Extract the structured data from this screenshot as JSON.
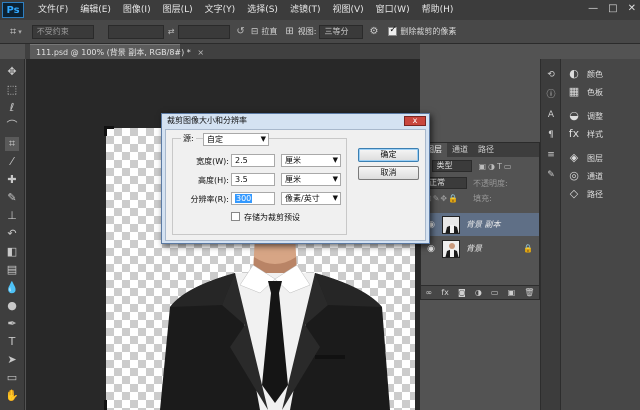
{
  "app": {
    "logo": "Ps",
    "menu": [
      "文件(F)",
      "编辑(E)",
      "图像(I)",
      "图层(L)",
      "文字(Y)",
      "选择(S)",
      "滤镜(T)",
      "视图(V)",
      "窗口(W)",
      "帮助(H)"
    ],
    "window_controls": [
      "—",
      "□",
      "✕"
    ]
  },
  "options_bar": {
    "ratio_select": "不受约束",
    "straighten_label": "拉直",
    "view_label": "视图:",
    "view_value": "三等分",
    "delete_cropped_label": "删除裁剪的像素",
    "delete_cropped_checked": true
  },
  "document": {
    "tab_title": "111.psd @ 100% (背景 副本, RGB/8#) *",
    "tab_close": "×"
  },
  "dock": {
    "items": [
      {
        "icon": "palette-icon",
        "label": "颜色"
      },
      {
        "icon": "swatches-icon",
        "label": "色板"
      },
      {
        "icon": "adjustments-icon",
        "label": "调整"
      },
      {
        "icon": "styles-icon",
        "label": "样式"
      },
      {
        "icon": "layers-icon",
        "label": "图层"
      },
      {
        "icon": "channels-icon",
        "label": "通道"
      },
      {
        "icon": "paths-icon",
        "label": "路径"
      }
    ]
  },
  "layers_panel": {
    "tabs": [
      "图层",
      "通道",
      "路径"
    ],
    "filter_select": "类型",
    "blend_mode": "正常",
    "opacity_label": "不透明度:",
    "fill_label": "填充:",
    "layers": [
      {
        "name": "背景 副本",
        "selected": true
      },
      {
        "name": "背景",
        "selected": false,
        "locked": true
      }
    ],
    "footer_icons": [
      "∞",
      "fx",
      "◙",
      "◑",
      "▭",
      "▣",
      "🗑"
    ]
  },
  "dialog": {
    "title": "裁剪图像大小和分辨率",
    "close": "x",
    "source_label": "源:",
    "source_value": "自定",
    "width_label": "宽度(W):",
    "width_value": "2.5",
    "width_unit": "厘米",
    "height_label": "高度(H):",
    "height_value": "3.5",
    "height_unit": "厘米",
    "resolution_label": "分辨率(R):",
    "resolution_value": "300",
    "resolution_unit": "像素/英寸",
    "save_preset_label": "存储为裁剪预设",
    "ok_label": "确定",
    "cancel_label": "取消"
  }
}
